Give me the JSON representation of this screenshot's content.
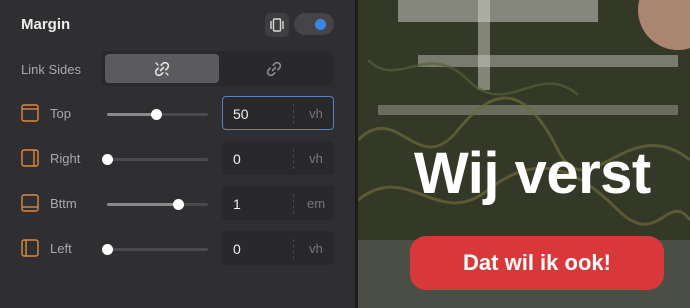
{
  "panel": {
    "title": "Margin",
    "toggle_on": true,
    "link_sides": {
      "label": "Link Sides",
      "options": [
        "linked",
        "unlinked"
      ],
      "selected": "linked"
    },
    "rows": [
      {
        "label": "Top",
        "icon": "margin-top-icon",
        "value": "50",
        "unit": "vh",
        "slider": 0.49,
        "focused": true
      },
      {
        "label": "Right",
        "icon": "margin-right-icon",
        "value": "0",
        "unit": "vh",
        "slider": 0.0,
        "focused": false
      },
      {
        "label": "Bttm",
        "icon": "margin-bottom-icon",
        "value": "1",
        "unit": "em",
        "slider": 0.7,
        "focused": false
      },
      {
        "label": "Left",
        "icon": "margin-left-icon",
        "value": "0",
        "unit": "vh",
        "slider": 0.0,
        "focused": false
      }
    ]
  },
  "preview": {
    "headline": "Wij verst",
    "cta_label": "Dat wil ik ook!"
  },
  "colors": {
    "accent_orange": "#e0883a",
    "toggle_blue": "#3a86e8",
    "cta_red": "#d9383b",
    "focus_border": "#4f86c6"
  }
}
